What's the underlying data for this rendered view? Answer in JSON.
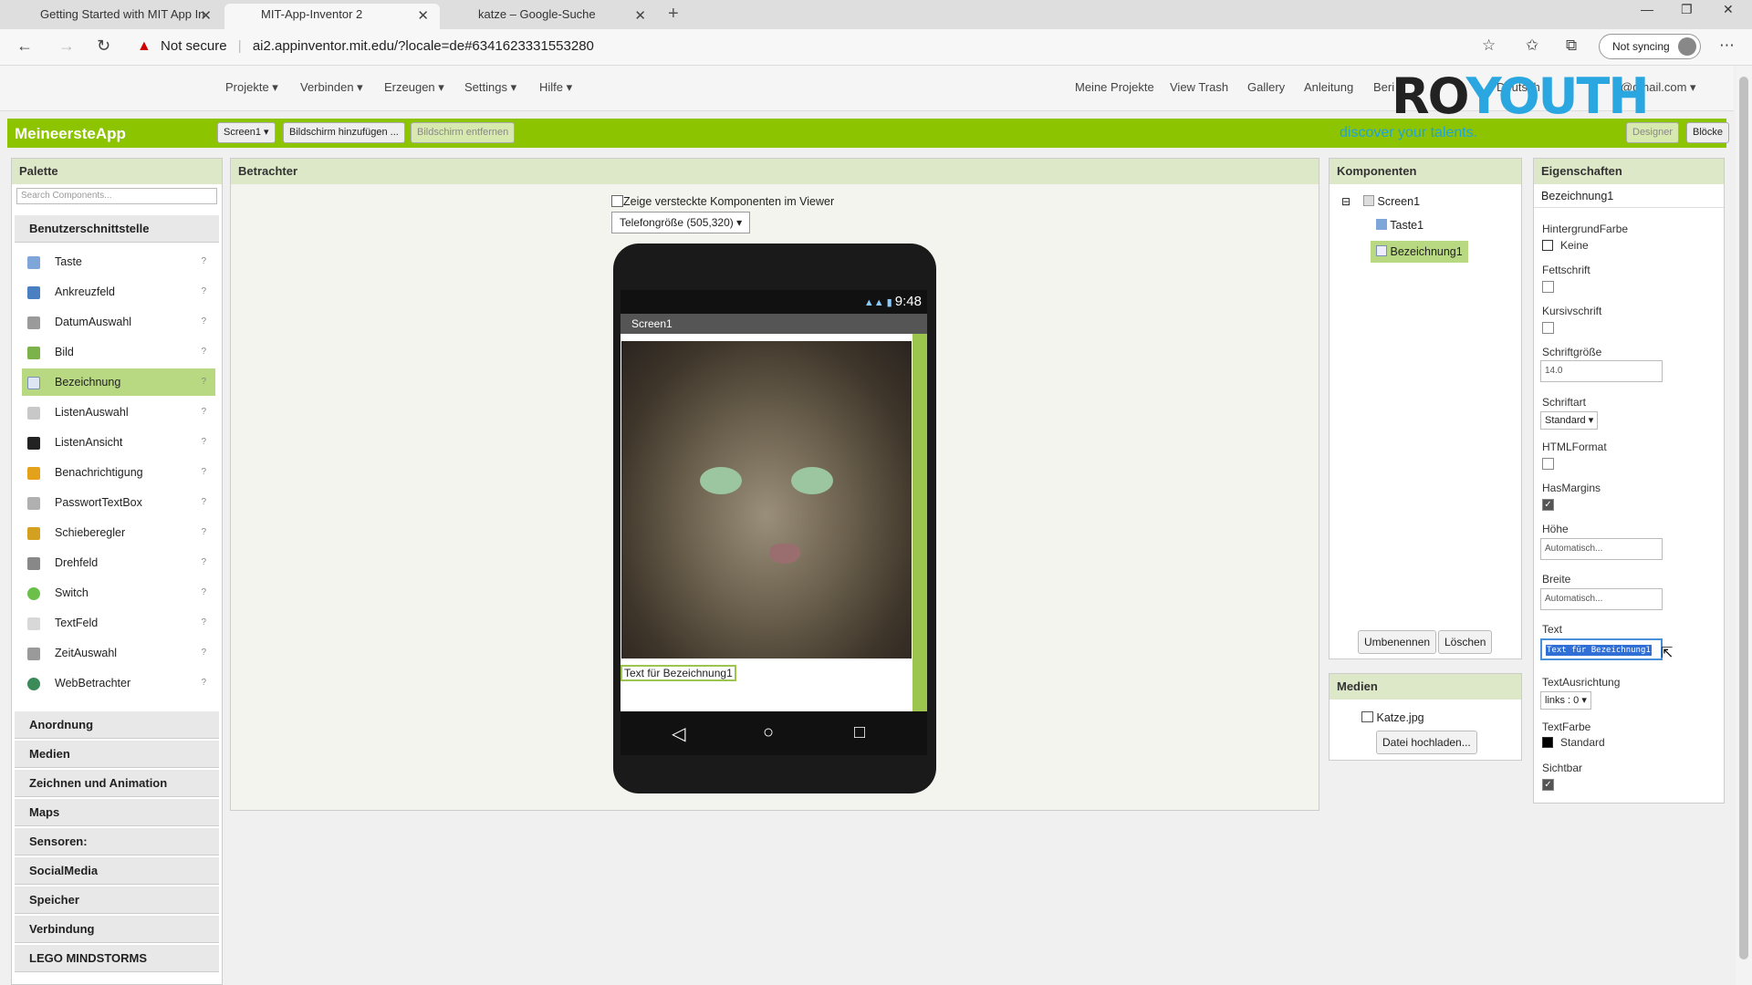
{
  "browser": {
    "tabs": [
      {
        "label": "Getting Started with MIT App In"
      },
      {
        "label": "MIT-App-Inventor 2"
      },
      {
        "label": "katze – Google-Suche"
      }
    ],
    "security": "Not secure",
    "url": "ai2.appinventor.mit.edu/?locale=de#6341623331553280",
    "sync": "Not syncing"
  },
  "menu": {
    "left": [
      "Projekte ▾",
      "Verbinden ▾",
      "Erzeugen ▾",
      "Settings ▾",
      "Hilfe ▾"
    ],
    "right": [
      "Meine Projekte",
      "View Trash",
      "Gallery",
      "Anleitung",
      "Beri",
      "Deutsch ▾",
      "@gmail.com ▾"
    ]
  },
  "overlay": {
    "logo_a": "RO",
    "logo_b": "YOUTH",
    "slogan": "discover your talents."
  },
  "appbar": {
    "title": "MeineersteApp",
    "screen_btn": "Screen1 ▾",
    "add_screen": "Bildschirm hinzufügen ...",
    "remove_screen": "Bildschirm entfernen",
    "designer": "Designer",
    "blocks": "Blöcke"
  },
  "palette": {
    "title": "Palette",
    "search_placeholder": "Search Components...",
    "section": "Benutzerschnittstelle",
    "items": [
      "Taste",
      "Ankreuzfeld",
      "DatumAuswahl",
      "Bild",
      "Bezeichnung",
      "ListenAuswahl",
      "ListenAnsicht",
      "Benachrichtigung",
      "PasswortTextBox",
      "Schieberegler",
      "Drehfeld",
      "Switch",
      "TextFeld",
      "ZeitAuswahl",
      "WebBetrachter"
    ],
    "categories": [
      "Anordnung",
      "Medien",
      "Zeichnen und Animation",
      "Maps",
      "Sensoren:",
      "SocialMedia",
      "Speicher",
      "Verbindung",
      "LEGO MINDSTORMS"
    ]
  },
  "viewer": {
    "title": "Betrachter",
    "hidden_toggle": "Zeige versteckte Komponenten im Viewer",
    "size_select": "Telefongröße (505,320) ▾",
    "time": "9:48",
    "screen_title": "Screen1",
    "label_text": "Text für Bezeichnung1",
    "nav_back": "◁",
    "nav_home": "○",
    "nav_recent": "□"
  },
  "components": {
    "title": "Komponenten",
    "tree": [
      "Screen1",
      "Taste1",
      "Bezeichnung1"
    ],
    "rename": "Umbenennen",
    "delete": "Löschen"
  },
  "media": {
    "title": "Medien",
    "file": "Katze.jpg",
    "upload": "Datei hochladen..."
  },
  "properties": {
    "title": "Eigenschaften",
    "component": "Bezeichnung1",
    "bg_label": "HintergrundFarbe",
    "bg_value": "Keine",
    "bold_label": "Fettschrift",
    "italic_label": "Kursivschrift",
    "fontsize_label": "Schriftgröße",
    "fontsize_value": "14.0",
    "font_label": "Schriftart",
    "font_value": "Standard ▾",
    "html_label": "HTMLFormat",
    "margins_label": "HasMargins",
    "height_label": "Höhe",
    "height_value": "Automatisch...",
    "width_label": "Breite",
    "width_value": "Automatisch...",
    "text_label": "Text",
    "text_value": "Text für Bezeichnung1",
    "align_label": "TextAusrichtung",
    "align_value": "links : 0 ▾",
    "color_label": "TextFarbe",
    "color_value": "Standard",
    "visible_label": "Sichtbar"
  }
}
